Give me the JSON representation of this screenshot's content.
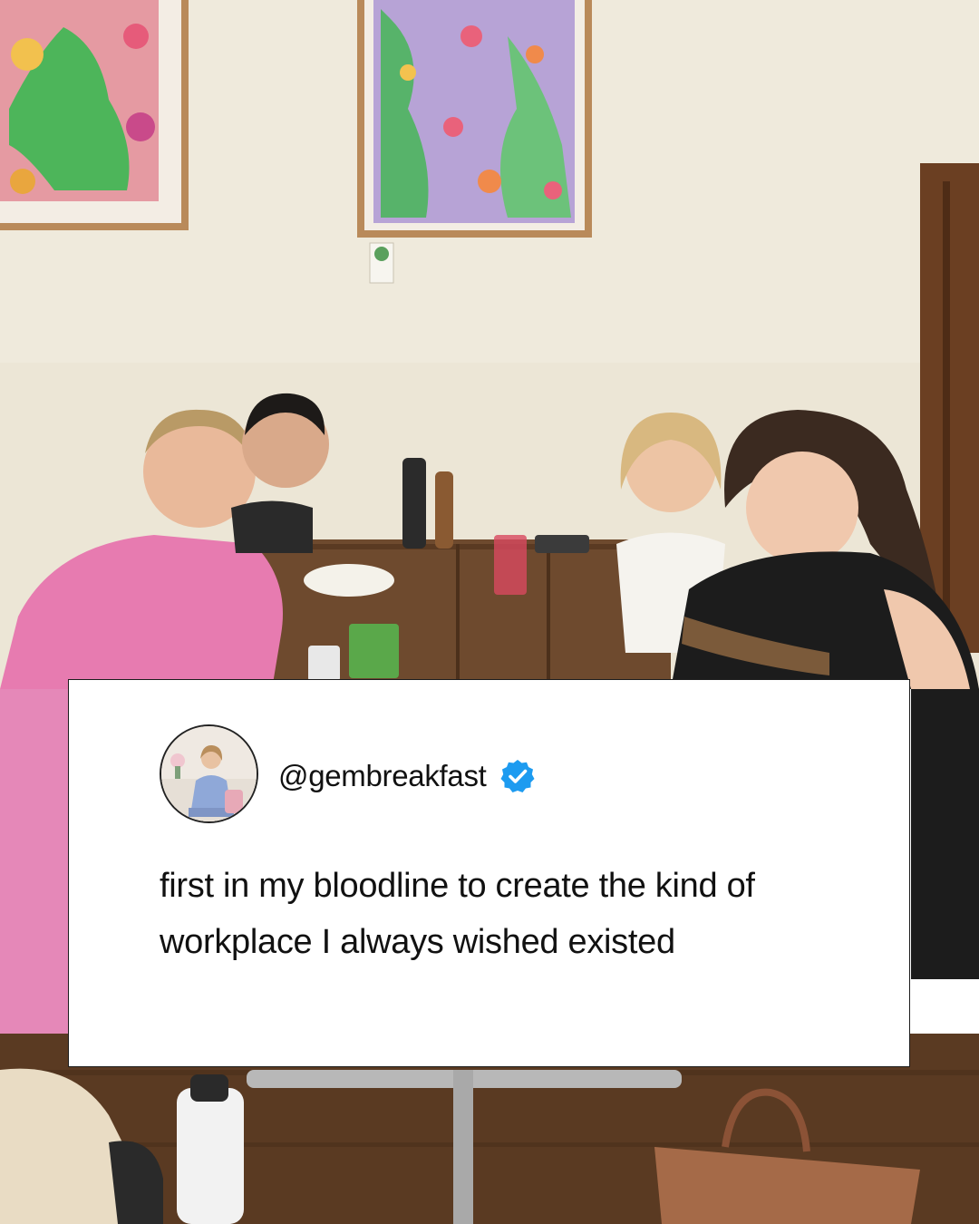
{
  "photo": {
    "scene": "cafe-group-photo",
    "colors": {
      "wall": "#ece6d6",
      "table": "#6e4a2e",
      "floor": "#5a3a22",
      "pink_dress": "#e77bb0",
      "black_dress": "#1c1c1c"
    }
  },
  "post": {
    "handle": "@gembreakfast",
    "verified_icon": "verified-badge-icon",
    "verified_color": "#1d9bf0",
    "text": "first in my bloodline to create the kind of workplace I always wished existed"
  }
}
